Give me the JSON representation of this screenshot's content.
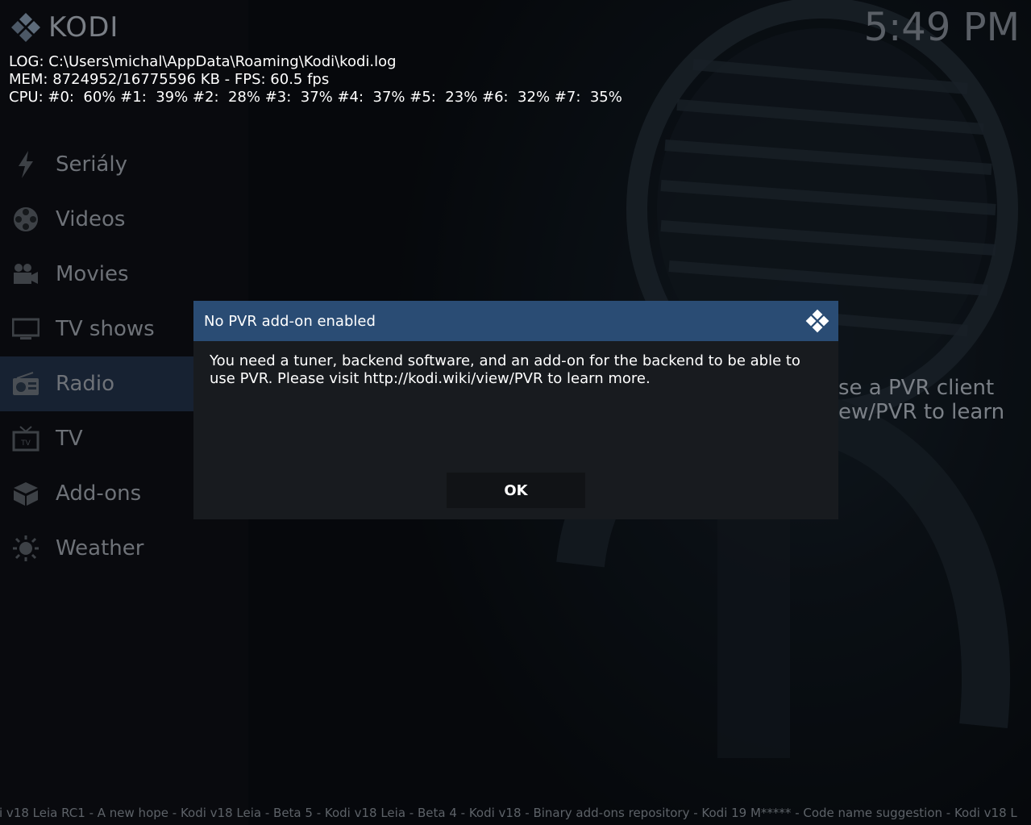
{
  "app": {
    "logo_text": "KODI"
  },
  "clock": "5:49 PM",
  "debug": {
    "log": "LOG: C:\\Users\\michal\\AppData\\Roaming\\Kodi\\kodi.log",
    "mem": "MEM: 8724952/16775596 KB - FPS: 60.5 fps",
    "cpu": "CPU: #0:  60% #1:  39% #2:  28% #3:  37% #4:  37% #5:  23% #6:  32% #7:  35%"
  },
  "sidebar": {
    "items": [
      {
        "label": "Seriály",
        "icon": "lightning-icon"
      },
      {
        "label": "Videos",
        "icon": "film-reel-icon"
      },
      {
        "label": "Movies",
        "icon": "camera-icon"
      },
      {
        "label": "TV shows",
        "icon": "monitor-icon"
      },
      {
        "label": "Radio",
        "icon": "radio-icon",
        "active": true
      },
      {
        "label": "TV",
        "icon": "tv-icon"
      },
      {
        "label": "Add-ons",
        "icon": "box-icon"
      },
      {
        "label": "Weather",
        "icon": "sun-icon"
      }
    ]
  },
  "background_message": {
    "line1": "se a PVR client",
    "line2": "ew/PVR to learn"
  },
  "dialog": {
    "title": "No PVR add-on enabled",
    "message": "You need a tuner, backend software, and an add-on for the backend to be able to use PVR. Please visit http://kodi.wiki/view/PVR to learn more.",
    "ok_label": "OK"
  },
  "ticker": "i v18 Leia RC1 - A new hope - Kodi v18 Leia - Beta 5 - Kodi v18 Leia - Beta 4 - Kodi v18 - Binary add-ons repository - Kodi 19 M***** - Code name suggestion - Kodi v18 L",
  "colors": {
    "accent": "#2a4c74",
    "dialog_bg": "#181b1f",
    "menu_text": "#6e7278"
  }
}
